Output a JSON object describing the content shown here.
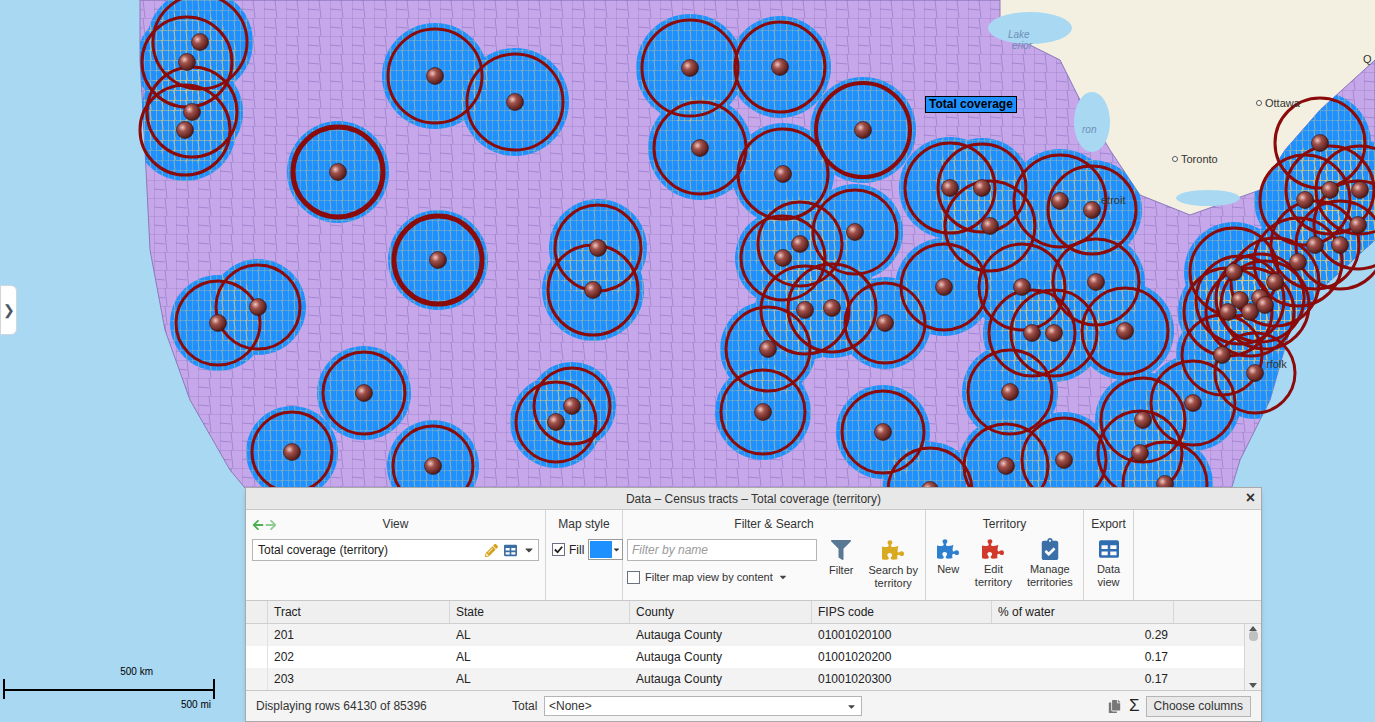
{
  "map": {
    "side_toggle": "❯",
    "territory_label": "Total coverage",
    "labels": [
      {
        "text": "Lake",
        "kind": "water"
      },
      {
        "text": "erior",
        "kind": "water"
      },
      {
        "text": "ron",
        "kind": "water"
      },
      {
        "text": "Ottawa",
        "kind": "city"
      },
      {
        "text": "Toronto",
        "kind": "city"
      },
      {
        "text": "etroit",
        "kind": "cut"
      },
      {
        "text": "rfolk",
        "kind": "cut"
      },
      {
        "text": "Q",
        "kind": "cut"
      }
    ],
    "scale": {
      "km": "500 km",
      "mi": "500 mi"
    }
  },
  "panel": {
    "title": "Data – Census tracts – Total coverage (territory)",
    "close": "×",
    "toolbar": {
      "view": {
        "label": "View",
        "value": "Total coverage (territory)"
      },
      "map_style": {
        "label": "Map style",
        "fill_label": "Fill",
        "fill": true,
        "color": "#1e90ff"
      },
      "filter_search": {
        "label": "Filter & Search",
        "placeholder": "Filter by name",
        "filter_map_view_label": "Filter map view by content",
        "filter_map_view": false,
        "buttons": [
          "Filter",
          "Search by territory"
        ]
      },
      "territory": {
        "label": "Territory",
        "buttons": [
          "New",
          "Edit territory",
          "Manage territories"
        ]
      },
      "export": {
        "label": "Export",
        "buttons": [
          "Data view"
        ]
      }
    },
    "table": {
      "columns": [
        "Tract",
        "State",
        "County",
        "FIPS code",
        "% of water"
      ],
      "rows": [
        {
          "cells": [
            "201",
            "AL",
            "Autauga County",
            "01001020100",
            "0.29"
          ]
        },
        {
          "cells": [
            "202",
            "AL",
            "Autauga County",
            "01001020200",
            "0.17"
          ]
        },
        {
          "cells": [
            "203",
            "AL",
            "Autauga County",
            "01001020300",
            "0.17"
          ]
        }
      ]
    },
    "footer": {
      "status": "Displaying rows 64130 of 85396",
      "total_label": "Total",
      "total_value": "<None>",
      "sigma": "Σ",
      "choose_columns": "Choose columns"
    }
  }
}
